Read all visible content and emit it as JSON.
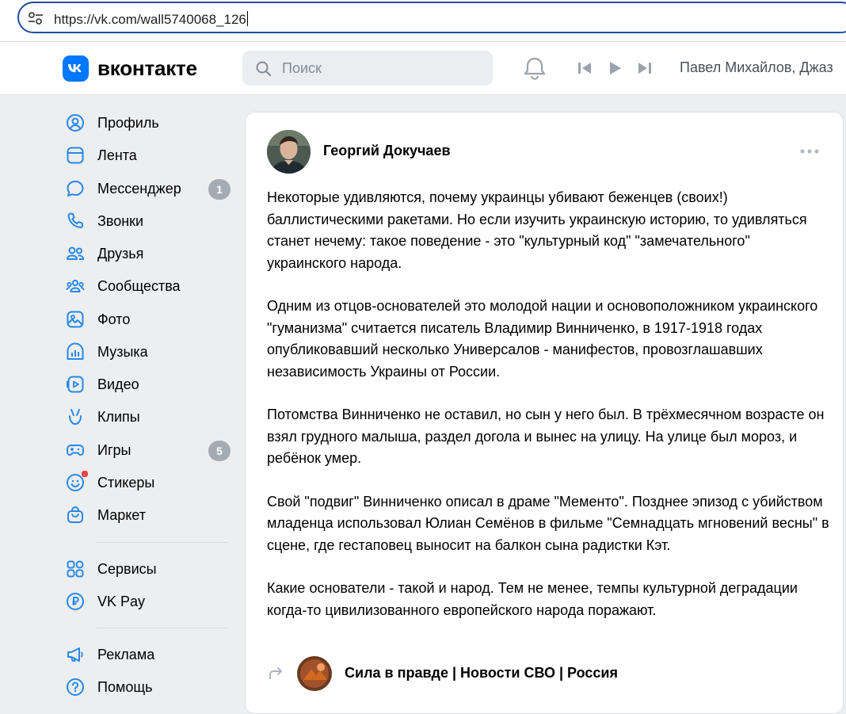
{
  "browser": {
    "url": "https://vk.com/wall5740068_126"
  },
  "header": {
    "logo_text": "вконтакте",
    "search_placeholder": "Поиск",
    "now_playing": "Павел Михайлов, Джаз"
  },
  "sidebar": {
    "items": [
      {
        "label": "Профиль",
        "icon": "profile-icon"
      },
      {
        "label": "Лента",
        "icon": "feed-icon"
      },
      {
        "label": "Мессенджер",
        "icon": "messenger-icon",
        "badge": "1"
      },
      {
        "label": "Звонки",
        "icon": "phone-icon"
      },
      {
        "label": "Друзья",
        "icon": "friends-icon"
      },
      {
        "label": "Сообщества",
        "icon": "communities-icon"
      },
      {
        "label": "Фото",
        "icon": "photo-icon"
      },
      {
        "label": "Музыка",
        "icon": "music-icon"
      },
      {
        "label": "Видео",
        "icon": "video-icon"
      },
      {
        "label": "Клипы",
        "icon": "clips-icon"
      },
      {
        "label": "Игры",
        "icon": "games-icon",
        "badge": "5"
      },
      {
        "label": "Стикеры",
        "icon": "stickers-icon"
      },
      {
        "label": "Маркет",
        "icon": "market-icon"
      },
      {
        "label": "Сервисы",
        "icon": "services-icon"
      },
      {
        "label": "VK Pay",
        "icon": "vkpay-icon"
      },
      {
        "label": "Реклама",
        "icon": "ads-icon"
      },
      {
        "label": "Помощь",
        "icon": "help-icon"
      }
    ]
  },
  "post": {
    "author": "Георгий Докучаев",
    "paragraphs": [
      "Некоторые удивляются, почему украинцы убивают беженцев (своих!) баллистическими ракетами. Но если изучить украинскую историю, то удивляться станет нечему: такое поведение - это \"культурный код\" \"замечательного\" украинского народа.",
      "Одним из отцов-основателей это молодой нации и основоположником украинского \"гуманизма\" считается писатель Владимир Винниченко, в 1917-1918 годах опубликовавший несколько Универсалов - манифестов, провозглашавших независимость Украины от России.",
      "Потомства Винниченко не оставил, но сын у него был. В трёхмесячном возрасте он взял грудного малыша, раздел догола и вынес на улицу. На улице был мороз, и ребёнок умер.",
      "Свой \"подвиг\" Винниченко описал в драме \"Мементо\". Позднее эпизод с убийством младенца использовал Юлиан Семёнов в фильме \"Семнадцать мгновений весны\" в сцене, где гестаповец выносит на балкон сына радистки Кэт.",
      "Какие основатели - такой и народ. Тем не менее, темпы культурной деградации когда-то цивилизованного европейского народа поражают."
    ],
    "repost_source": "Сила в правде | Новости СВО | Россия"
  },
  "colors": {
    "accent": "#0077ff",
    "icon": "#2688eb",
    "badge": "#a4abb3"
  }
}
